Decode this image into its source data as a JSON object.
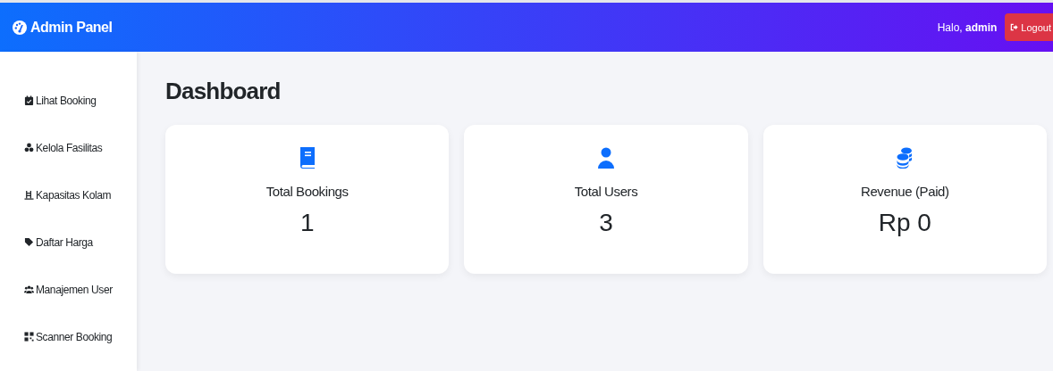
{
  "navbar": {
    "brand": "Admin Panel",
    "greeting": "Halo,",
    "username": "admin",
    "logout_button": "Logout"
  },
  "sidebar": {
    "items": [
      {
        "label": "Lihat Booking"
      },
      {
        "label": "Kelola Fasilitas"
      },
      {
        "label": "Kapasitas Kolam"
      },
      {
        "label": "Daftar Harga"
      },
      {
        "label": "Manajemen User"
      },
      {
        "label": "Scanner Booking"
      }
    ]
  },
  "page_title": "Dashboard",
  "stat_cards": [
    {
      "label": "Total Bookings",
      "value": "1"
    },
    {
      "label": "Total Users",
      "value": "3"
    },
    {
      "label": "Revenue (Paid)",
      "value": "Rp 0"
    }
  ]
}
